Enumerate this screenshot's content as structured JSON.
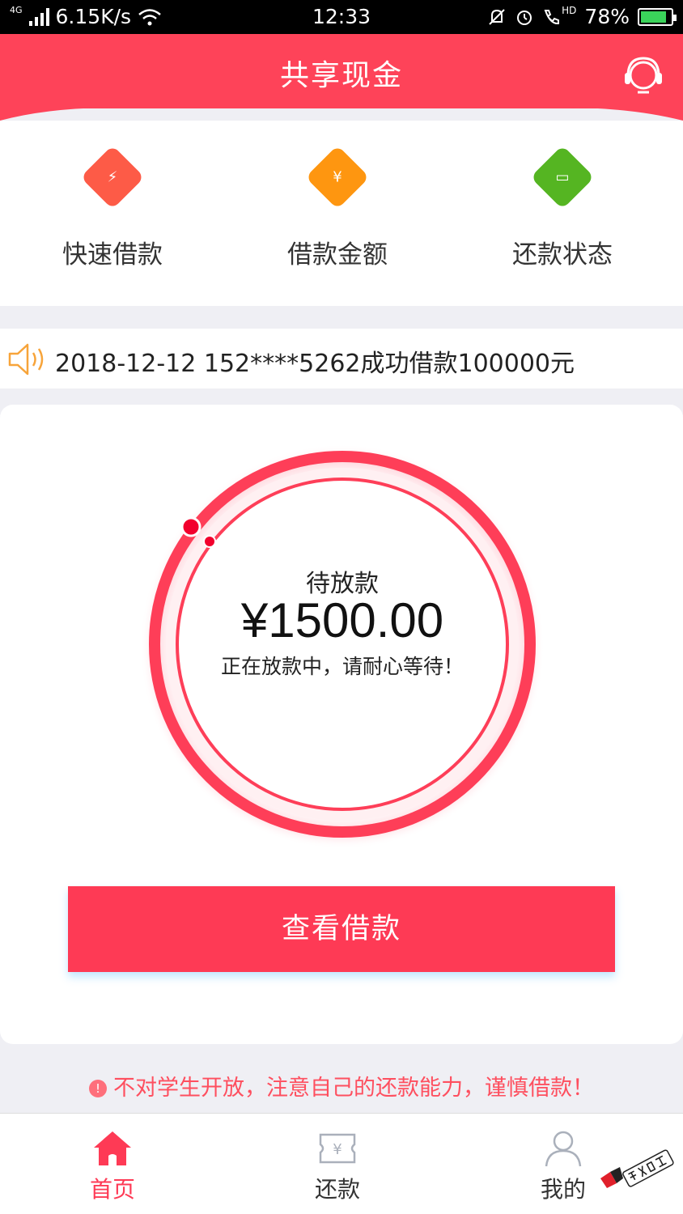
{
  "status_bar": {
    "network": "4G",
    "speed": "6.15K/s",
    "time": "12:33",
    "hd": "HD",
    "battery": "78%"
  },
  "header": {
    "title": "共享现金"
  },
  "quick_menu": [
    {
      "label": "快速借款",
      "color": "#fd5b47",
      "glyph": "⚡"
    },
    {
      "label": "借款金额",
      "color": "#fe9610",
      "glyph": "¥"
    },
    {
      "label": "还款状态",
      "color": "#55b522",
      "glyph": "▭"
    }
  ],
  "notice": {
    "text": "2018-12-12 152****5262成功借款100000元"
  },
  "loan_card": {
    "status_label": "待放款",
    "amount": "¥1500.00",
    "message": "正在放款中，请耐心等待！",
    "button_label": "查看借款"
  },
  "warning": {
    "icon": "!",
    "text": "不对学生开放，注意自己的还款能力，谨慎借款！"
  },
  "tabs": [
    {
      "label": "首页",
      "active": true
    },
    {
      "label": "还款",
      "active": false
    },
    {
      "label": "我的",
      "active": false
    }
  ],
  "colors": {
    "brand": "#fe4359",
    "button": "#fe3a55",
    "warning": "#fe4f5f"
  }
}
